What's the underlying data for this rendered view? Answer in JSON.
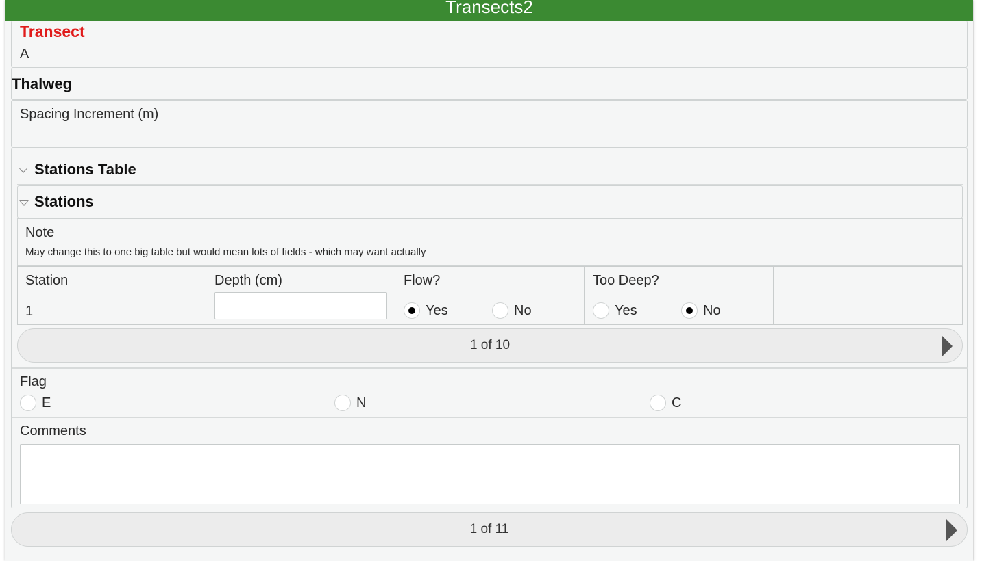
{
  "window": {
    "title": "Transects2"
  },
  "transect": {
    "label": "Transect",
    "value": "A"
  },
  "thalweg": {
    "heading": "Thalweg"
  },
  "spacing": {
    "label": "Spacing Increment (m)"
  },
  "stations_table": {
    "heading": "Stations Table"
  },
  "stations": {
    "heading": "Stations"
  },
  "note": {
    "label": "Note",
    "text": "May change this to one big table but would mean lots of fields - which may want actually"
  },
  "columns": {
    "station": {
      "label": "Station",
      "value": "1"
    },
    "depth": {
      "label": "Depth (cm)",
      "value": ""
    },
    "flow": {
      "label": "Flow?",
      "options": [
        "Yes",
        "No"
      ],
      "selected": "Yes"
    },
    "too_deep": {
      "label": "Too Deep?",
      "options": [
        "Yes",
        "No"
      ],
      "selected": "No"
    }
  },
  "stations_pager": {
    "text": "1 of 10"
  },
  "flag": {
    "label": "Flag",
    "options": [
      "E",
      "N",
      "C"
    ],
    "selected": null
  },
  "comments": {
    "label": "Comments",
    "value": ""
  },
  "main_pager": {
    "text": "1 of 11"
  },
  "icons": {
    "collapse": "triangle-down-icon",
    "next": "play-arrow-icon",
    "radio": "radio-circle-icon"
  }
}
